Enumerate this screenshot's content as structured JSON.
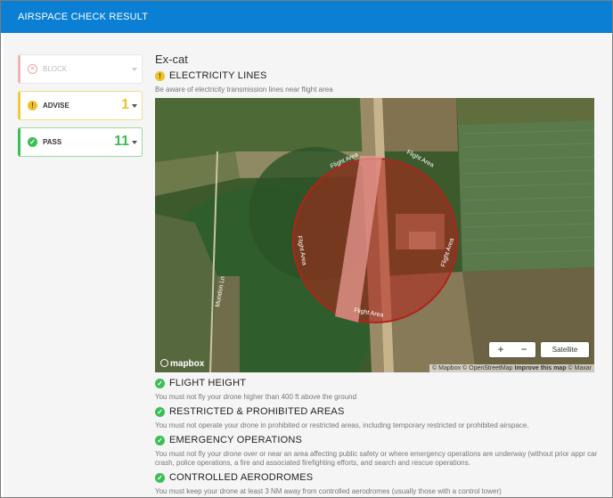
{
  "window": {
    "title": "AIRSPACE CHECK RESULT"
  },
  "sidebar": {
    "block": {
      "label": "BLOCK",
      "count": ""
    },
    "advise": {
      "label": "ADVISE",
      "count": "1"
    },
    "pass": {
      "label": "PASS",
      "count": "11"
    }
  },
  "main": {
    "group_title": "Ex-cat",
    "sections": [
      {
        "status": "advise",
        "title": "ELECTRICITY LINES",
        "desc": "Be aware of electricity transmission lines near flight area"
      },
      {
        "status": "pass",
        "title": "FLIGHT HEIGHT",
        "desc": "You must not fly your drone higher than 400 ft above the ground"
      },
      {
        "status": "pass",
        "title": "RESTRICTED & PROHIBITED AREAS",
        "desc": "You must not operate your drone in prohibited or restricted areas, including temporary restricted or prohibited airspace."
      },
      {
        "status": "pass",
        "title": "EMERGENCY OPERATIONS",
        "desc": "You must not fly your drone over or near an area affecting public safety or where emergency operations are underway (without prior appr car crash, police operations, a fire and associated firefighting efforts, and search and rescue operations."
      },
      {
        "status": "pass",
        "title": "CONTROLLED AERODROMES",
        "desc": "You must keep your drone at least 3 NM away from controlled aerodromes (usually those with a control tower)"
      }
    ]
  },
  "map": {
    "area_label": "Flight Area",
    "road_label": "Mundon Ln",
    "zoom_in": "+",
    "zoom_out": "−",
    "layer_button": "Satellite",
    "logo": "mapbox",
    "attribution": "© Mapbox © OpenStreetMap",
    "improve": "Improve this map",
    "maxar": "© Maxar",
    "area_color": "#b3221c"
  },
  "icons": {
    "block": "circle-x-icon",
    "advise": "warning-icon",
    "pass": "check-icon"
  }
}
